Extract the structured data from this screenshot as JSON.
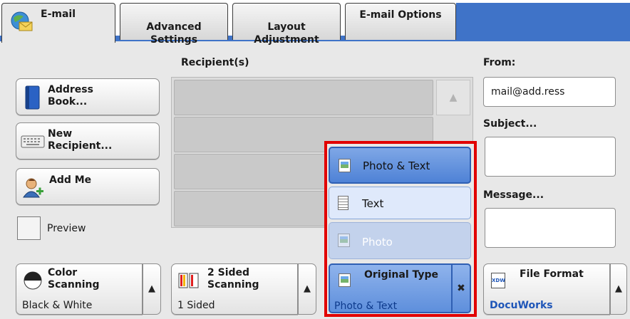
{
  "tabs": [
    {
      "label": "E-mail"
    },
    {
      "label": "Advanced\nSettings"
    },
    {
      "label": "Layout\nAdjustment"
    },
    {
      "label": "E-mail Options"
    }
  ],
  "left": {
    "address_book": "Address\nBook...",
    "new_recipient": "New\nRecipient...",
    "add_me": "Add Me",
    "preview": "Preview"
  },
  "recipients": {
    "header": "Recipient(s)",
    "scroll_up": "▲"
  },
  "right": {
    "from_label": "From:",
    "from_value": "mail@add.ress",
    "subject_label": "Subject...",
    "message_label": "Message..."
  },
  "bottom": {
    "color": {
      "title": "Color\nScanning",
      "value": "Black & White",
      "arrow": "▲"
    },
    "sided": {
      "title": "2 Sided\nScanning",
      "value": "1 Sided",
      "arrow": "▲"
    },
    "original": {
      "title": "Original Type",
      "value": "Photo & Text",
      "close": "✖"
    },
    "format": {
      "title": "File Format",
      "value": "DocuWorks",
      "arrow": "▲",
      "icon_text": "XDW"
    }
  },
  "popup": {
    "options": [
      "Photo & Text",
      "Text",
      "Photo"
    ]
  },
  "colors": {
    "accent_blue": "#3f73c8",
    "highlight_red": "#e10000",
    "link_blue": "#1f56b8"
  }
}
